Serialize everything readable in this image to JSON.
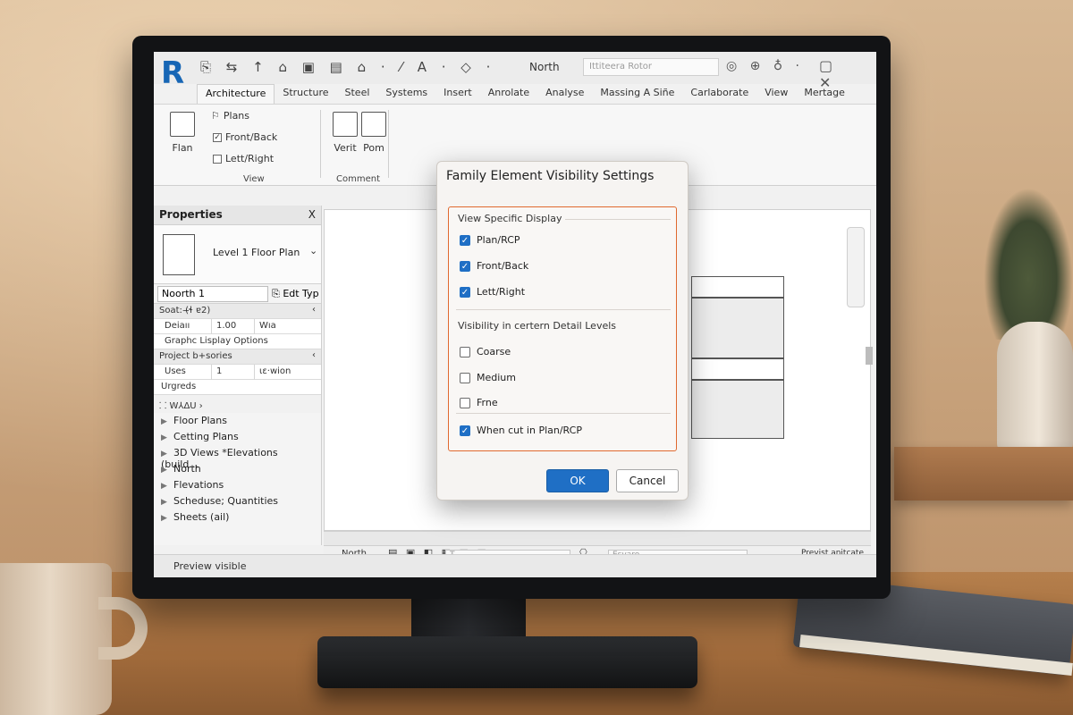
{
  "app": {
    "logo_letter": "R",
    "center_title": "North",
    "search_placeholder": "Ittiteera Rotor"
  },
  "quick_access_icons": "⎘ ⇆ ↑ ⌂ ▣ ▤ ⌂ · ⁄ A · ◇ ·",
  "tabs": [
    {
      "label": "Architecture"
    },
    {
      "label": "Structure"
    },
    {
      "label": "Steel"
    },
    {
      "label": "Systems"
    },
    {
      "label": "Insert"
    },
    {
      "label": "Anrolate"
    },
    {
      "label": "Analyse"
    },
    {
      "label": "Massing A Siñe"
    },
    {
      "label": "Carlaborate"
    },
    {
      "label": "View"
    },
    {
      "label": "Mertage"
    }
  ],
  "ribbon": {
    "plan_label": "Flan",
    "plans_label": "Plans",
    "front_back_label": "Front/Back",
    "left_right_label": "Lett/Right",
    "view_group": "View",
    "verit_label": "Verit",
    "pom_label": "Pom",
    "comment_group": "Comment"
  },
  "properties": {
    "title": "Properties",
    "close": "X",
    "type_name": "Level 1 Floor Plan",
    "instance_value": "Noorth 1",
    "edit_type": "Edt Typ",
    "rows": [
      {
        "c1": "Soat: (̶ɬ ɐ2)",
        "c2": "",
        "c3": "",
        "cat": true
      },
      {
        "c1": "Deiaıı",
        "c2": "1.00",
        "c3": "Wıa",
        "cat": false
      },
      {
        "c1": "Graphc Lisplay Options",
        "c2": "",
        "c3": "",
        "cat": false
      },
      {
        "c1": "Project b+sories",
        "c2": "",
        "c3": "",
        "cat": true
      },
      {
        "c1": "Uses",
        "c2": "1",
        "c3": "ɩɛ·wion",
        "cat": false
      },
      {
        "c1": "Urgreds",
        "c2": "",
        "c3": "",
        "cat": false
      }
    ]
  },
  "browser": {
    "header": "⸬ W⅄ΔU ›",
    "items": [
      {
        "label": "Floor Plans"
      },
      {
        "label": "Cetting Plans"
      },
      {
        "label": "3D Views *Elevations (build..."
      },
      {
        "label": "North"
      },
      {
        "label": "Flevations"
      },
      {
        "label": "Scheduse; Quantities"
      },
      {
        "label": "Sheets (ail)"
      }
    ]
  },
  "view_bar": {
    "scale_label": "North",
    "input_placeholder": "Ŧ",
    "workset_placeholder": "Esvaro",
    "status_right": "Previst anitcate"
  },
  "status": {
    "text": "Preview visible"
  },
  "dialog": {
    "title": "Family Element Visibility Settings",
    "section1": "View Specific Display",
    "section2": "Visibility in certern Detail Levels",
    "options1": [
      {
        "label": "Plan/RCP",
        "checked": true
      },
      {
        "label": "Front/Back",
        "checked": true
      },
      {
        "label": "Lett/Right",
        "checked": true
      }
    ],
    "options2": [
      {
        "label": "Coarse",
        "checked": false
      },
      {
        "label": "Medium",
        "checked": false
      },
      {
        "label": "Frne",
        "checked": false
      }
    ],
    "cut_option": {
      "label": "When cut in Plan/RCP",
      "checked": true
    },
    "ok": "OK",
    "cancel": "Cancel"
  },
  "colors": {
    "accent": "#1f6fc5",
    "frame": "#e0692f",
    "brand": "#1766b5"
  }
}
